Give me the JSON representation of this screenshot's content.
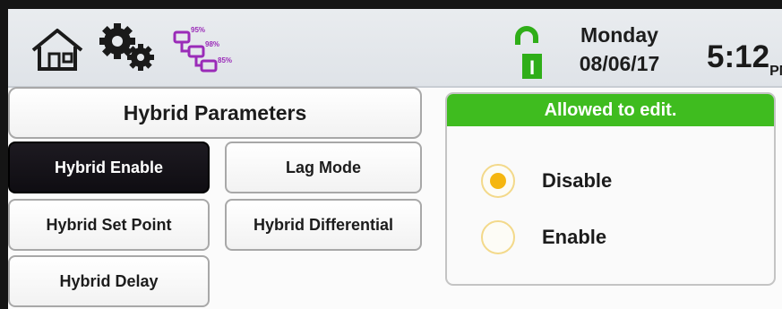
{
  "header": {
    "icons": [
      "home-icon",
      "gear-icon",
      "network-status-icon",
      "unlocked-icon"
    ],
    "network_levels": [
      "95%",
      "98%",
      "85%"
    ],
    "lock_indicator": "I",
    "day": "Monday",
    "date": "08/06/17",
    "time": "5:12",
    "ampm": "PM"
  },
  "title": "Hybrid Parameters",
  "menu": [
    {
      "label": "Hybrid Enable",
      "active": true
    },
    {
      "label": "Lag Mode",
      "active": false
    },
    {
      "label": "Hybrid Set Point",
      "active": false
    },
    {
      "label": "Hybrid Differential",
      "active": false
    },
    {
      "label": "Hybrid Delay",
      "active": false
    }
  ],
  "panel": {
    "status": "Allowed to edit.",
    "options": [
      {
        "label": "Disable",
        "selected": true
      },
      {
        "label": "Enable",
        "selected": false
      }
    ]
  },
  "colors": {
    "status_green": "#3fbc1f",
    "radio_selected": "#f5b610",
    "active_button": "#17141a",
    "network_purple": "#9a2bb8"
  }
}
